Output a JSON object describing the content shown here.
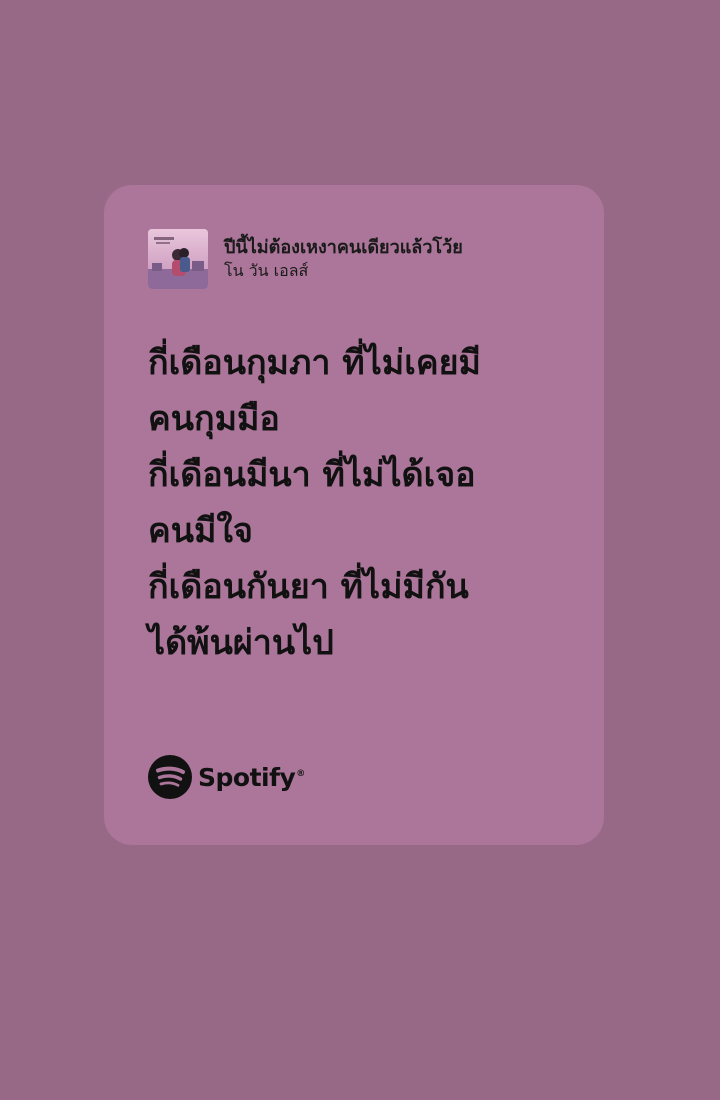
{
  "background_color": "#976987",
  "card_color": "#ab7699",
  "track": {
    "title": "ปีนี้ไม่ต้องเหงาคนเดียวแล้วโว้ย",
    "artist": "โน วัน เอลส์",
    "cover_icon": "album-cover-image"
  },
  "lyrics": [
    "กี่เดือนกุมภา ที่ไม่เคยมี",
    "คนกุมมือ",
    "กี่เดือนมีนา ที่ไม่ได้เจอ",
    "คนมีใจ",
    "กี่เดือนกันยา ที่ไม่มีกัน",
    "ได้พ้นผ่านไป"
  ],
  "brand": {
    "icon": "spotify-logo-icon",
    "name": "Spotify",
    "reg_mark": "®"
  }
}
